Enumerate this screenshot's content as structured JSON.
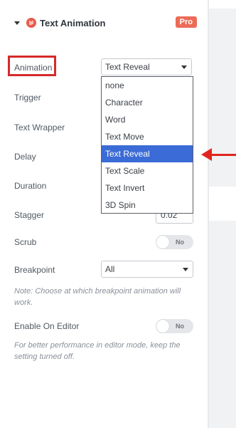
{
  "section": {
    "title": "Text Animation",
    "badge": "Pro"
  },
  "fields": {
    "animation": {
      "label": "Animation",
      "value": "Text Reveal"
    },
    "trigger": {
      "label": "Trigger"
    },
    "text_wrapper": {
      "label": "Text Wrapper"
    },
    "delay": {
      "label": "Delay"
    },
    "duration": {
      "label": "Duration"
    },
    "stagger": {
      "label": "Stagger",
      "value": "0.02"
    },
    "scrub": {
      "label": "Scrub",
      "toggle": "No"
    },
    "breakpoint": {
      "label": "Breakpoint",
      "value": "All",
      "note": "Note: Choose at which breakpoint animation will work."
    },
    "enable_on_editor": {
      "label": "Enable On Editor",
      "toggle": "No",
      "note": "For better performance in editor mode, keep the setting turned off."
    }
  },
  "dropdown": {
    "options": [
      "none",
      "Character",
      "Word",
      "Text Move",
      "Text Reveal",
      "Text Scale",
      "Text Invert",
      "3D Spin"
    ],
    "selected_index": 4
  },
  "colors": {
    "accent_highlight": "#3b6bd6",
    "annotation_red": "#e0261f",
    "pro_badge": "#ec6b58"
  }
}
